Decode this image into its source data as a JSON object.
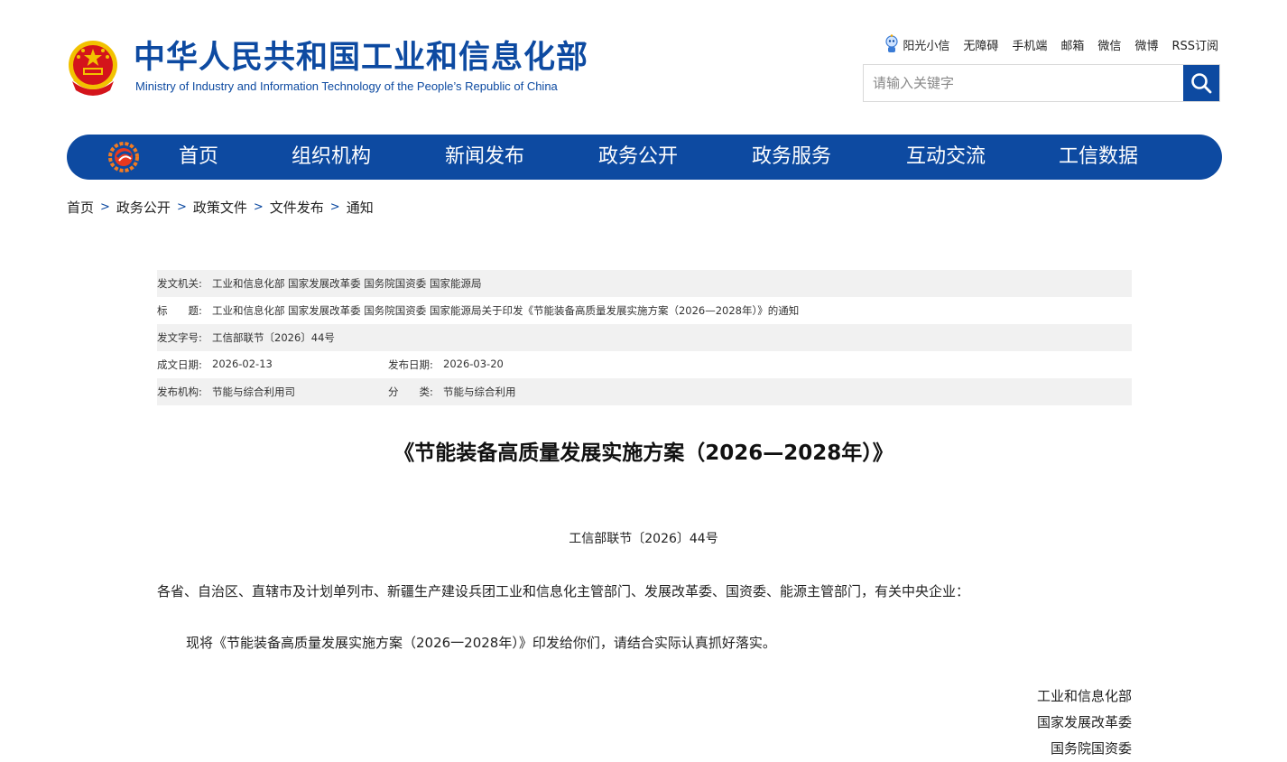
{
  "header": {
    "title": "中华人民共和国工业和信息化部",
    "subtitle": "Ministry of Industry and Information Technology of the People’s Republic of China",
    "emblem_icon": "national-emblem-icon",
    "top_links": [
      "阳光小信",
      "无障碍",
      "手机端",
      "邮箱",
      "微信",
      "微博",
      "RSS订阅"
    ],
    "search_placeholder": "请输入关键字",
    "brand_color": "#0d4aa1"
  },
  "nav": {
    "items": [
      "首页",
      "组织机构",
      "新闻发布",
      "政务公开",
      "政务服务",
      "互动交流",
      "工信数据"
    ]
  },
  "breadcrumb": [
    "首页",
    "政务公开",
    "政策文件",
    "文件发布",
    "通知"
  ],
  "meta": {
    "issuer_label": "发文机关:",
    "issuer": "工业和信息化部 国家发展改革委 国务院国资委 国家能源局",
    "title_label": "标　　题:",
    "title": "工业和信息化部 国家发展改革委 国务院国资委 国家能源局关于印发《节能装备高质量发展实施方案（2026—2028年）》的通知",
    "docno_label": "发文字号:",
    "docno": "工信部联节〔2026〕44号",
    "created_label": "成文日期:",
    "created": "2026-02-13",
    "published_label": "发布日期:",
    "published": "2026-03-20",
    "org_label": "发布机构:",
    "org": "节能与综合利用司",
    "category_label": "分　　类:",
    "category": "节能与综合利用"
  },
  "document": {
    "title": "《节能装备高质量发展实施方案（2026—2028年）》",
    "number": "工信部联节〔2026〕44号",
    "recipients": "各省、自治区、直辖市及计划单列市、新疆生产建设兵团工业和信息化主管部门、发展改革委、国资委、能源主管部门，有关中央企业：",
    "body": "现将《节能装备高质量发展实施方案（2026一2028年）》印发给你们，请结合实际认真抓好落实。",
    "signatories": [
      "工业和信息化部",
      "国家发展改革委",
      "国务院国资委"
    ]
  }
}
